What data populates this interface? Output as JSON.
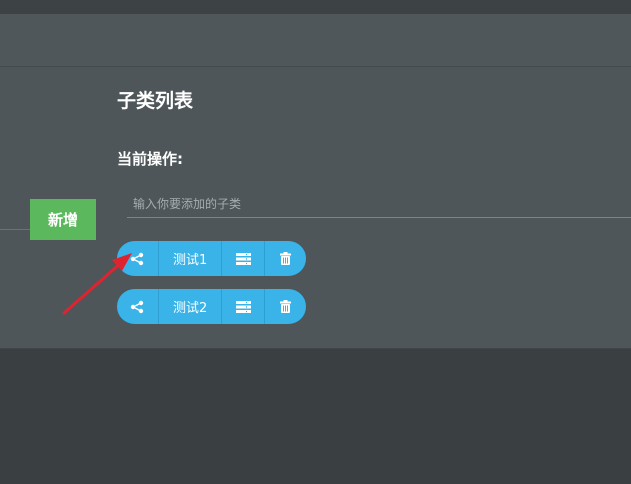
{
  "panel": {
    "title": "子类列表",
    "current_operation_label": "当前操作:",
    "input_placeholder": "输入你要添加的子类",
    "add_button_label": "新增"
  },
  "items": [
    {
      "name": "测试1"
    },
    {
      "name": "测试2"
    }
  ],
  "colors": {
    "accent": "#39b3e8",
    "add_button": "#5cb85c",
    "annotation_arrow": "#e0242f"
  }
}
